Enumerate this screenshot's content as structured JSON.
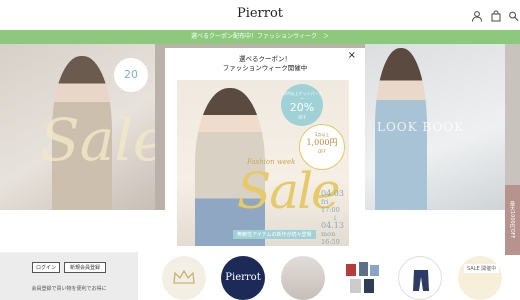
{
  "header": {
    "logo": "Pierrot",
    "icons": [
      "user-icon",
      "bag-icon",
      "search-icon"
    ]
  },
  "banner": {
    "text": "選べるクーポン配布中！ファッションウィーク　＞"
  },
  "hero": {
    "left_title": "Sale",
    "right_title": "LOOK BOOK",
    "left_badge": "20",
    "side_tab": "最大1000円OFF"
  },
  "modal": {
    "title_line1": "選べるクーポン！",
    "title_line2": "ファッションウィーク開催中",
    "close": "×",
    "poster": {
      "coupon1_line1": "10円以上ゲットパーカー",
      "coupon1_value": "20%",
      "coupon1_suffix": "OFF",
      "coupon2_line1": "3点以上",
      "coupon2_value": "1,000円",
      "coupon2_suffix": "OFF",
      "script": "Fashion week",
      "sale": "Sale",
      "tagline": "無敵性アイテムの新作が続々登場",
      "date1": "04.03",
      "time1": "fri 17:00",
      "arrow": "↓",
      "date2": "04.13",
      "time2": "mon 16:59"
    }
  },
  "login": {
    "login_button": "ログイン",
    "register_button": "新規会員登録",
    "note": "会員登録で買い物を便利でお得に"
  },
  "categories": {
    "brand": "Pierrot",
    "badge": "SALE 開催中"
  },
  "colors": {
    "banner": "#8dc97d",
    "navy": "#1b2a56",
    "gold": "#e6c969",
    "teal": "#9fd1d6",
    "sidetab": "#b6938d"
  }
}
